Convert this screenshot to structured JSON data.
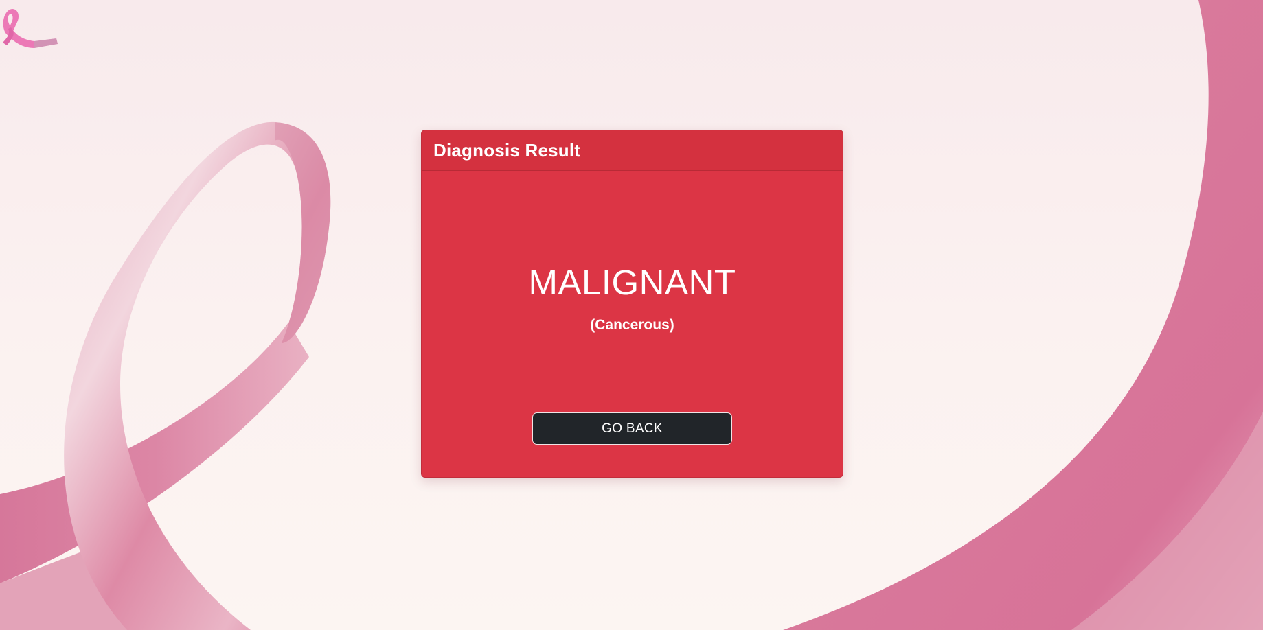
{
  "background": {
    "theme": "pink-ribbon-awareness",
    "base_color": "#fbf3f0",
    "ribbon_color": "#d97b9c"
  },
  "logo": {
    "icon": "pink-ribbon-icon"
  },
  "card": {
    "header_title": "Diagnosis Result",
    "result": "MALIGNANT",
    "result_detail": "(Cancerous)",
    "button_label": "GO BACK",
    "accent_color": "#dc3545",
    "button_color": "#212529"
  }
}
